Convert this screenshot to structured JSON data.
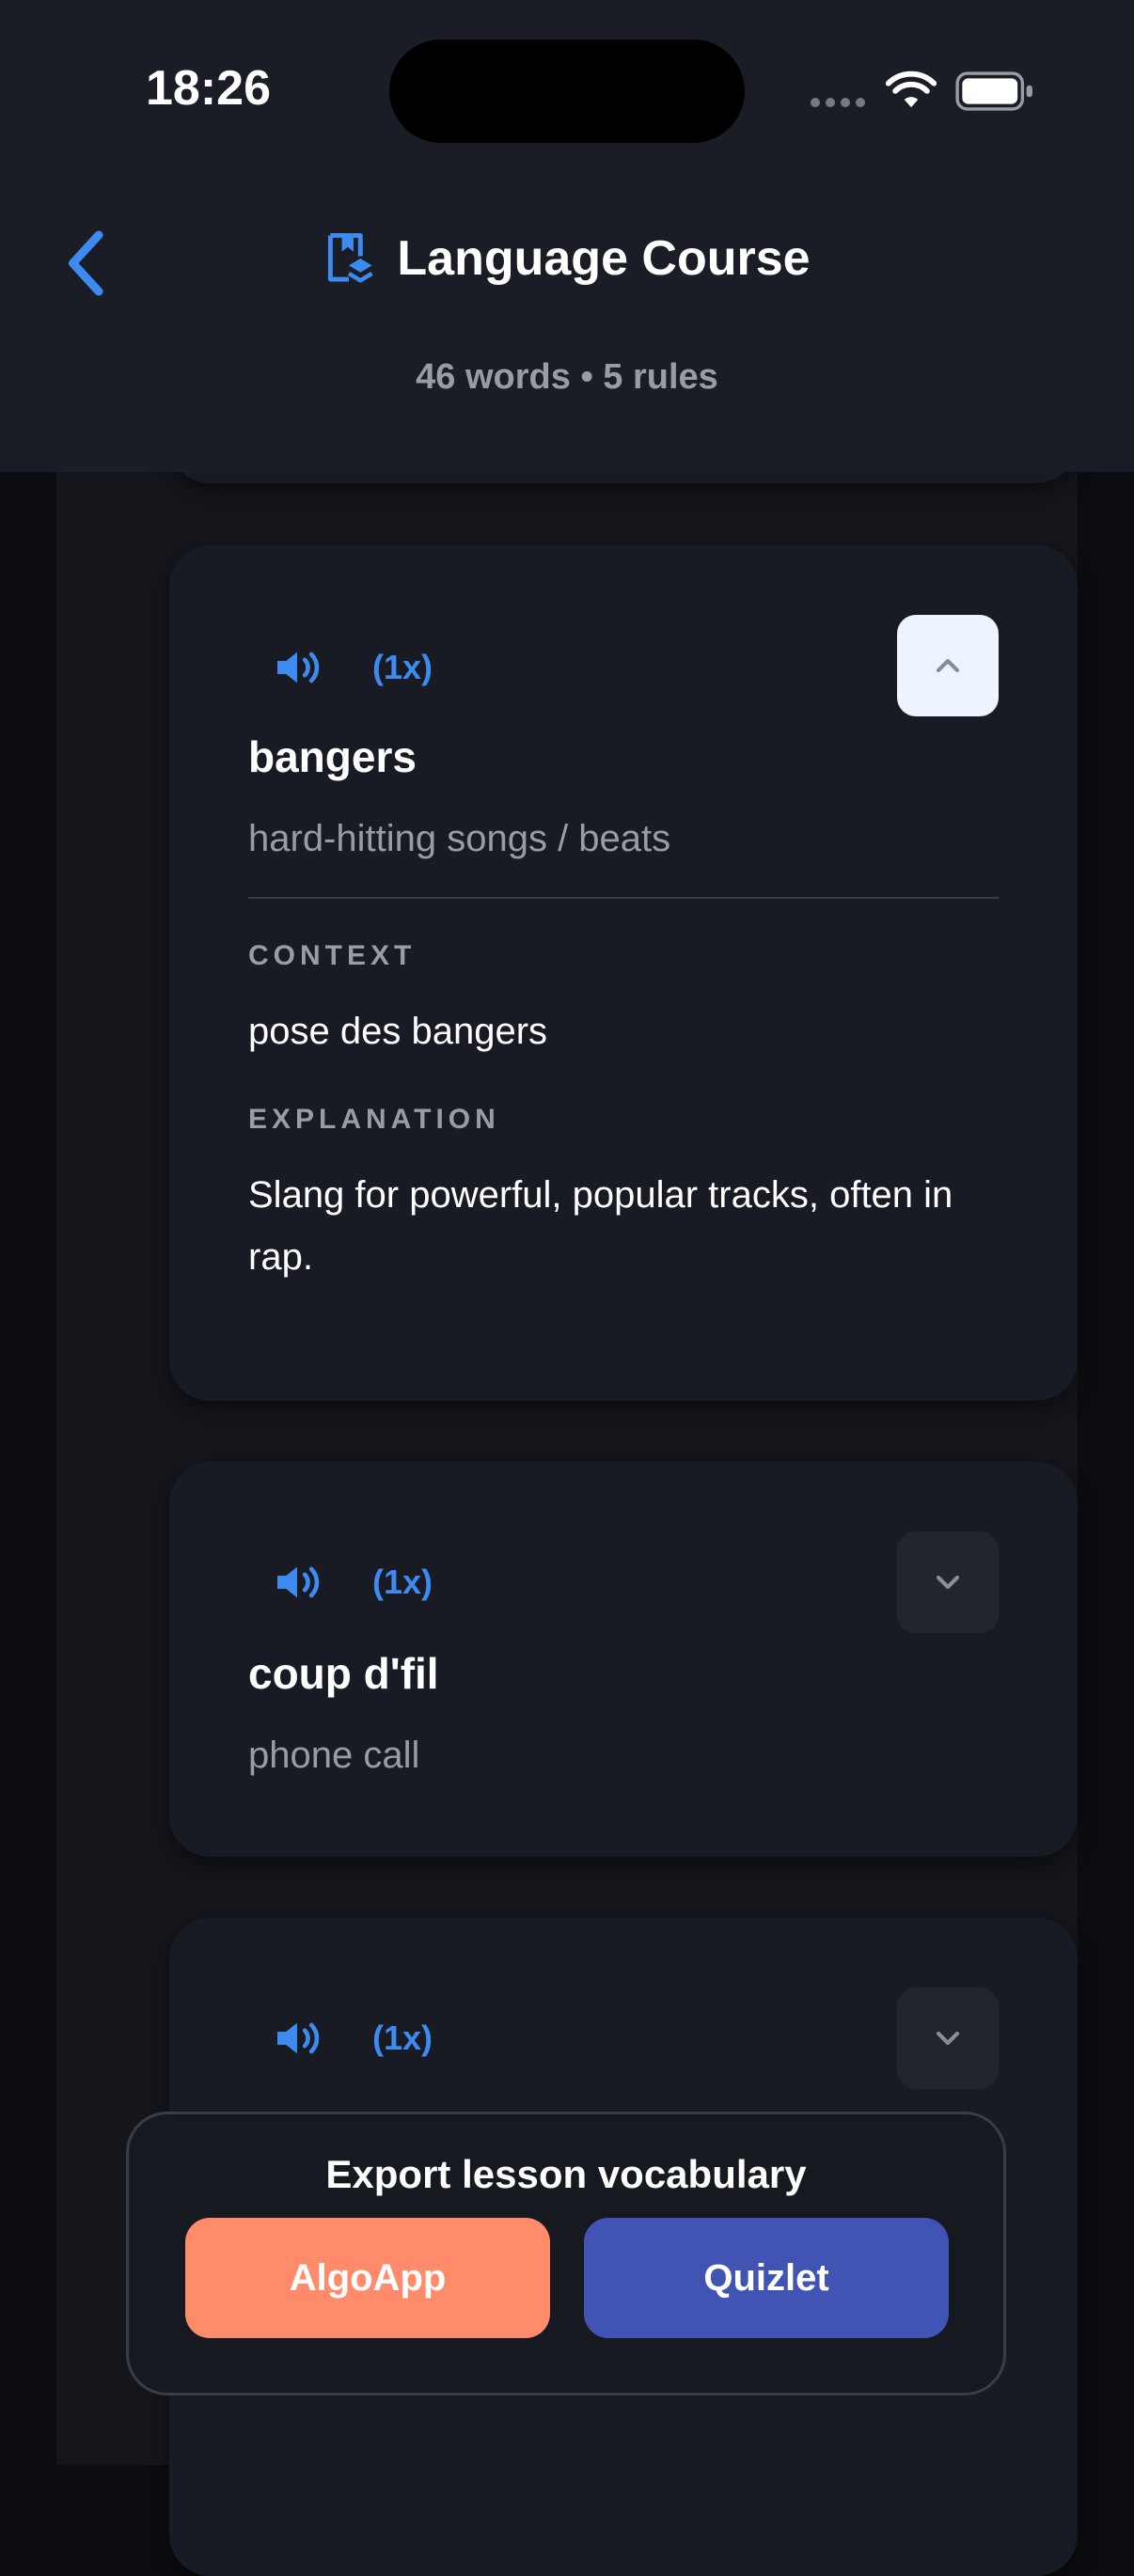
{
  "status_bar": {
    "time": "18:26"
  },
  "header": {
    "title": "Language Course",
    "subtitle": "46 words • 5 rules"
  },
  "cards": [
    {
      "speed": "(1x)",
      "term": "bangers",
      "translation": "hard-hitting songs / beats",
      "expanded": true,
      "context_label": "CONTEXT",
      "context": "pose des bangers",
      "explanation_label": "EXPLANATION",
      "explanation": "Slang for powerful, popular tracks, often in rap."
    },
    {
      "speed": "(1x)",
      "term": "coup d'fil",
      "translation": "phone call",
      "expanded": false
    },
    {
      "speed": "(1x)",
      "expanded": false
    }
  ],
  "export": {
    "title": "Export lesson vocabulary",
    "buttons": [
      "AlgoApp",
      "Quizlet"
    ],
    "colors": {
      "algoapp": "#ff8b6a",
      "quizlet": "#4254b3"
    }
  },
  "colors": {
    "accent": "#3d8bf0",
    "background": "#14161c"
  },
  "icons": [
    "back-chevron-icon",
    "book-icon",
    "speaker-icon",
    "chevron-up-icon",
    "chevron-down-icon"
  ]
}
